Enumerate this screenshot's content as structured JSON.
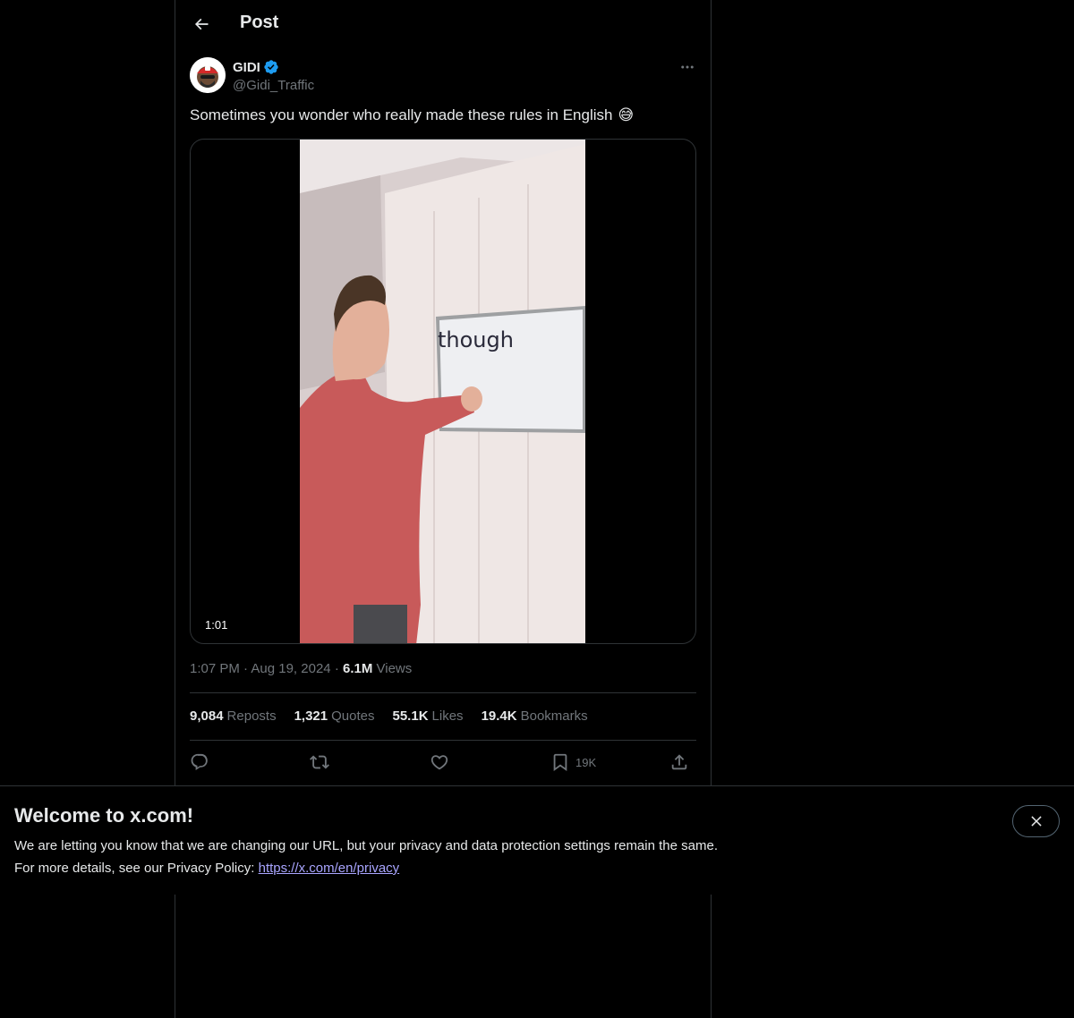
{
  "header": {
    "title": "Post"
  },
  "author": {
    "name": "GIDI",
    "handle": "@Gidi_Traffic",
    "verified": true,
    "verified_color": "#1d9bf0"
  },
  "tweet": {
    "text": "Sometimes you wonder who really made these rules in English",
    "emoji": "😅",
    "video": {
      "duration": "1:01",
      "whiteboard_word": "though"
    }
  },
  "meta": {
    "time": "1:07 PM",
    "separator": "·",
    "date": "Aug 19, 2024",
    "views_count": "6.1M",
    "views_label": "Views"
  },
  "stats": {
    "reposts_count": "9,084",
    "reposts_label": "Reposts",
    "quotes_count": "1,321",
    "quotes_label": "Quotes",
    "likes_count": "55.1K",
    "likes_label": "Likes",
    "bookmarks_count": "19.4K",
    "bookmarks_label": "Bookmarks"
  },
  "actions": {
    "bookmark_count": "19K"
  },
  "banner": {
    "title": "Welcome to x.com!",
    "line1": "We are letting you know that we are changing our URL, but your privacy and data protection settings remain the same.",
    "line2_prefix": "For more details, see our Privacy Policy:",
    "link_text": "https://x.com/en/privacy"
  },
  "colors": {
    "background": "#000000",
    "text_primary": "#e7e9ea",
    "text_secondary": "#71767b",
    "border": "#2f3336",
    "link": "#a9a5ff"
  }
}
